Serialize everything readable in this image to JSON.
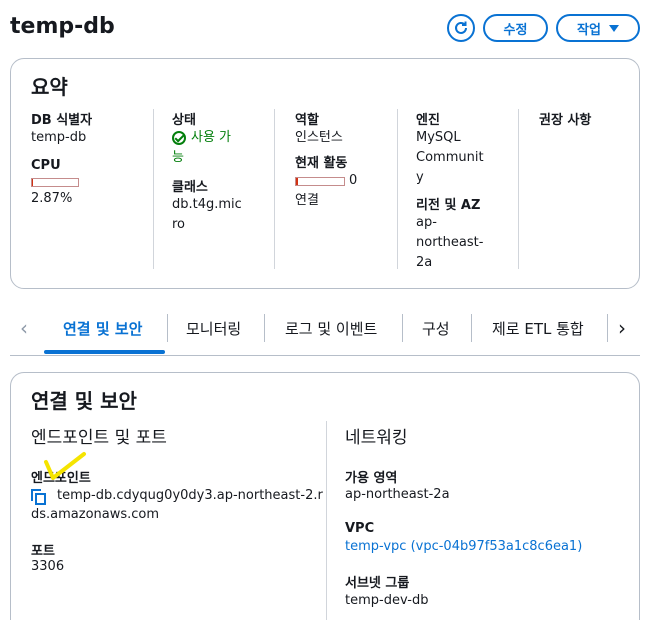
{
  "header": {
    "title": "temp-db",
    "refresh_icon": "refresh-icon",
    "edit_label": "수정",
    "actions_label": "작업"
  },
  "summary": {
    "title": "요약",
    "db_id_label": "DB 식별자",
    "db_id_value": "temp-db",
    "cpu_label": "CPU",
    "cpu_value": "2.87%",
    "cpu_percent": 2.87,
    "status_label": "상태",
    "status_line1": "사용 가",
    "status_line2": "능",
    "class_label": "클래스",
    "class_line1": "db.t4g.mic",
    "class_line2": "ro",
    "role_label": "역할",
    "role_value": "인스턴스",
    "activity_label": "현재 활동",
    "activity_count": "0",
    "activity_unit": "연결",
    "engine_label": "엔진",
    "engine_line1": "MySQL",
    "engine_line2": "Communit",
    "engine_line3": "y",
    "region_label": "리전 및 AZ",
    "region_line1": "ap-",
    "region_line2": "northeast-",
    "region_line3": "2a",
    "recommend_label": "권장 사항"
  },
  "tabs": {
    "items": [
      "연결 및 보안",
      "모니터링",
      "로그 및 이벤트",
      "구성",
      "제로 ETL 통합"
    ],
    "active": "연결 및 보안"
  },
  "connectivity": {
    "title": "연결 및 보안",
    "endpoint_section": "엔드포인트 및 포트",
    "endpoint_label": "엔드포인트",
    "endpoint_line1": "temp-db.cdyqug0y0dy3.ap-northeast-2.r",
    "endpoint_line2": "ds.amazonaws.com",
    "port_label": "포트",
    "port_value": "3306",
    "network_section": "네트워킹",
    "az_label": "가용 영역",
    "az_value": "ap-northeast-2a",
    "vpc_label": "VPC",
    "vpc_value": "temp-vpc (vpc-04b97f53a1c8c6ea1)",
    "subnet_label": "서브넷 그룹",
    "subnet_value": "temp-dev-db"
  },
  "colors": {
    "accent": "#0972d3",
    "success": "#037f0c",
    "annotation": "#f5e400"
  }
}
